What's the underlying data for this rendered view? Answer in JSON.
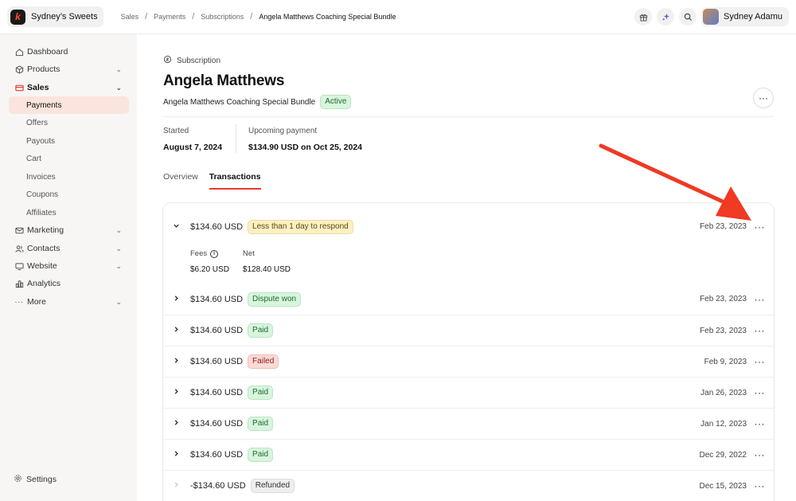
{
  "brand": {
    "name": "Sydney’s Sweets",
    "logo_letter": "k"
  },
  "breadcrumb": [
    "Sales",
    "Payments",
    "Subscriptions",
    "Angela Matthews Coaching Special Bundle"
  ],
  "user": {
    "name": "Sydney Adamu"
  },
  "sidebar": {
    "items": [
      {
        "label": "Dashboard"
      },
      {
        "label": "Products"
      },
      {
        "label": "Sales"
      },
      {
        "label": "Marketing"
      },
      {
        "label": "Contacts"
      },
      {
        "label": "Website"
      },
      {
        "label": "Analytics"
      },
      {
        "label": "More"
      }
    ],
    "sales_sub": [
      "Payments",
      "Offers",
      "Payouts",
      "Cart",
      "Invoices",
      "Coupons",
      "Affiliates"
    ],
    "settings": "Settings"
  },
  "header": {
    "kind": "Subscription",
    "title": "Angela Matthews",
    "product": "Angela Matthews Coaching Special Bundle",
    "status": "Active",
    "more": "···"
  },
  "stats": {
    "started_label": "Started",
    "started_value": "August 7, 2024",
    "upcoming_label": "Upcoming payment",
    "upcoming_value": "$134.90 USD on Oct 25, 2024"
  },
  "tabs": [
    "Overview",
    "Transactions"
  ],
  "transactions": [
    {
      "amount": "$134.60 USD",
      "status": "Less than 1 day to respond",
      "date": "Feb 23, 2023"
    },
    {
      "amount": "$134.60 USD",
      "status": "Dispute won",
      "date": "Feb 23, 2023"
    },
    {
      "amount": "$134.60 USD",
      "status": "Paid",
      "date": "Feb 23, 2023"
    },
    {
      "amount": "$134.60 USD",
      "status": "Failed",
      "date": "Feb 9, 2023"
    },
    {
      "amount": "$134.60 USD",
      "status": "Paid",
      "date": "Jan 26, 2023"
    },
    {
      "amount": "$134.60 USD",
      "status": "Paid",
      "date": "Jan 12, 2023"
    },
    {
      "amount": "$134.60 USD",
      "status": "Paid",
      "date": "Dec 29, 2022"
    },
    {
      "amount": "-$134.60 USD",
      "status": "Refunded",
      "date": "Dec 15, 2023"
    }
  ],
  "expanded": {
    "fees_label": "Fees",
    "fees_value": "$6.20 USD",
    "net_label": "Net",
    "net_value": "$128.40 USD"
  },
  "colors": {
    "accent": "#ea3b2a",
    "arrow": "#f03a23"
  }
}
